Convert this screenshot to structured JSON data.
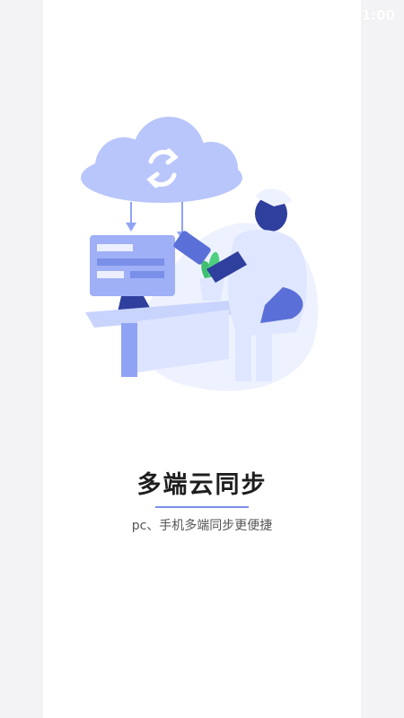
{
  "status_bar": {
    "time": "1:00"
  },
  "onboarding": {
    "title": "多端云同步",
    "subtitle": "pc、手机多端同步更便捷",
    "illustration_icon": "cloud-sync-icon"
  },
  "colors": {
    "accent": "#7a8fe8",
    "illustration_primary": "#8fa3f5",
    "illustration_dark": "#2f3f9e",
    "plant": "#3fbf6f"
  }
}
